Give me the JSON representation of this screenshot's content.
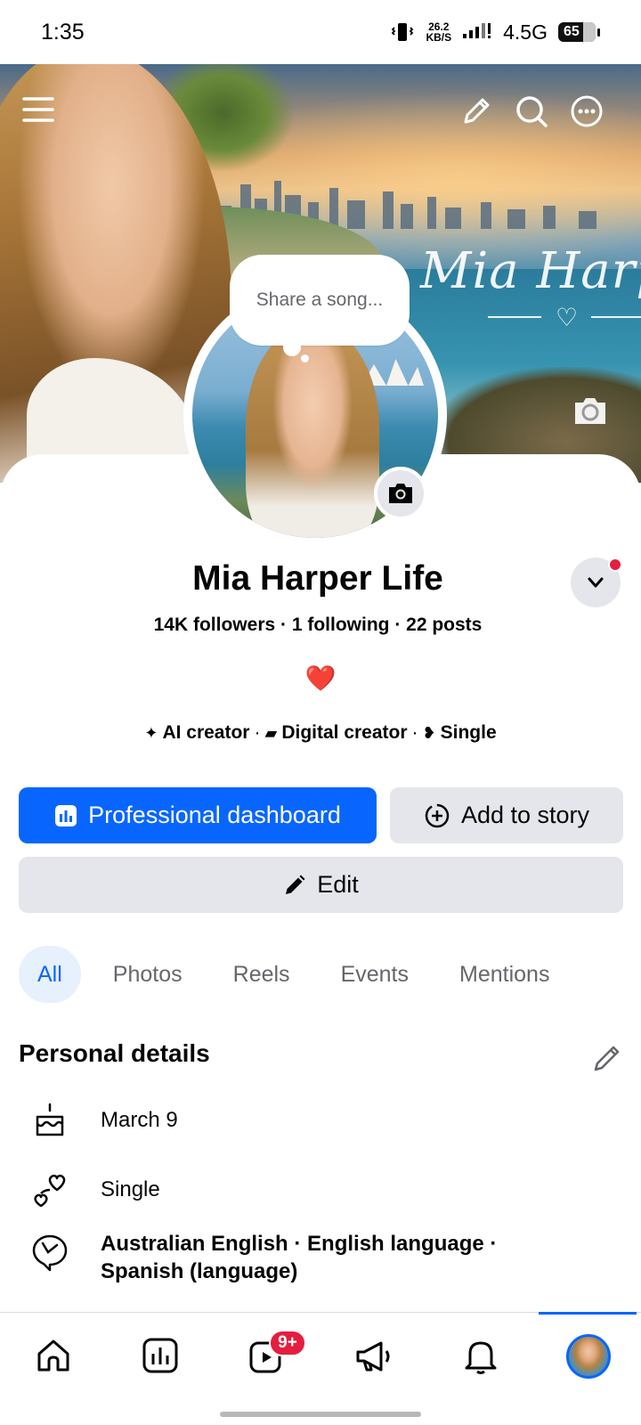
{
  "status_bar": {
    "time": "1:35",
    "speed_value": "26.2",
    "speed_unit": "KB/S",
    "network": "4.5G",
    "battery": "65"
  },
  "cover": {
    "script_text": "Mia Harper"
  },
  "song_bubble": {
    "placeholder": "Share a song..."
  },
  "profile": {
    "name": "Mia Harper Life",
    "stats": "14K followers · 1 following · 22 posts",
    "bio": "❤️",
    "categories": [
      {
        "icon": "sparkle-icon",
        "label": "AI creator"
      },
      {
        "icon": "clapperboard-icon",
        "label": "Digital creator"
      },
      {
        "icon": "hearts-icon",
        "label": "Single"
      }
    ]
  },
  "actions": {
    "dashboard_label": "Professional dashboard",
    "add_story_label": "Add to story",
    "edit_label": "Edit"
  },
  "tabs": [
    "All",
    "Photos",
    "Reels",
    "Events",
    "Mentions"
  ],
  "active_tab": "All",
  "personal_details": {
    "title": "Personal details",
    "items": [
      {
        "icon": "birthday-cake-icon",
        "text": "March 9"
      },
      {
        "icon": "relationship-hearts-icon",
        "text": "Single"
      },
      {
        "icon": "speech-bubbles-icon",
        "text": "Australian English · English language · Spanish (language)"
      }
    ]
  },
  "bottom_nav": {
    "items": [
      "home-icon",
      "dashboard-icon",
      "video-icon",
      "megaphone-icon",
      "bell-icon",
      "profile-avatar"
    ],
    "video_badge": "9+",
    "active": "profile-avatar"
  },
  "colors": {
    "primary": "#0866ff",
    "secondary_button": "#e4e6eb",
    "notification_red": "#e41e3f",
    "active_tab_bg": "#e7f0fd"
  }
}
